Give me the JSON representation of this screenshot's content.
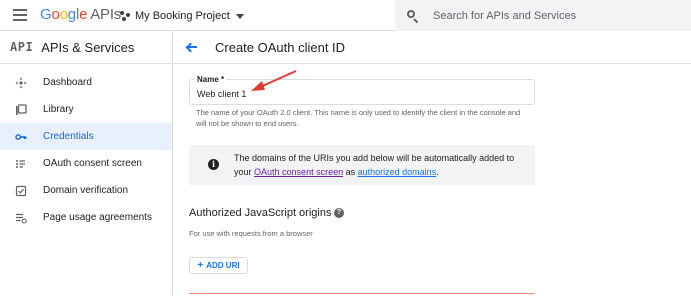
{
  "header": {
    "logo_google": [
      "G",
      "o",
      "o",
      "g",
      "l",
      "e"
    ],
    "logo_apis": "APIs",
    "project_name": "My Booking Project",
    "search_placeholder": "Search for APIs and Services"
  },
  "sidebar": {
    "api_logo": "API",
    "title": "APIs & Services",
    "items": [
      {
        "label": "Dashboard",
        "icon": "dashboard-icon",
        "active": false
      },
      {
        "label": "Library",
        "icon": "library-icon",
        "active": false
      },
      {
        "label": "Credentials",
        "icon": "key-icon",
        "active": true
      },
      {
        "label": "OAuth consent screen",
        "icon": "consent-icon",
        "active": false
      },
      {
        "label": "Domain verification",
        "icon": "domain-verification-icon",
        "active": false
      },
      {
        "label": "Page usage agreements",
        "icon": "settings-list-icon",
        "active": false
      }
    ]
  },
  "main": {
    "title": "Create OAuth client ID",
    "name_field": {
      "label": "Name *",
      "value": "Web client 1",
      "helper": "The name of your OAuth 2.0 client. This name is only used to identify the client in the console and will not be shown to end users."
    },
    "callout": {
      "text_1": "The domains of the URIs you add below will be automatically added to",
      "text_2": "your",
      "link_consent": "OAuth consent screen",
      "text_3": "as",
      "link_domains": "authorized domains",
      "text_4": "."
    },
    "origins": {
      "title": "Authorized JavaScript origins",
      "subtitle": "For use with requests from a browser",
      "add_button": "ADD URI"
    }
  },
  "colors": {
    "accent": "#1a73e8",
    "active_bg": "#e8f0fe",
    "annotation_arrow": "#e53935"
  }
}
